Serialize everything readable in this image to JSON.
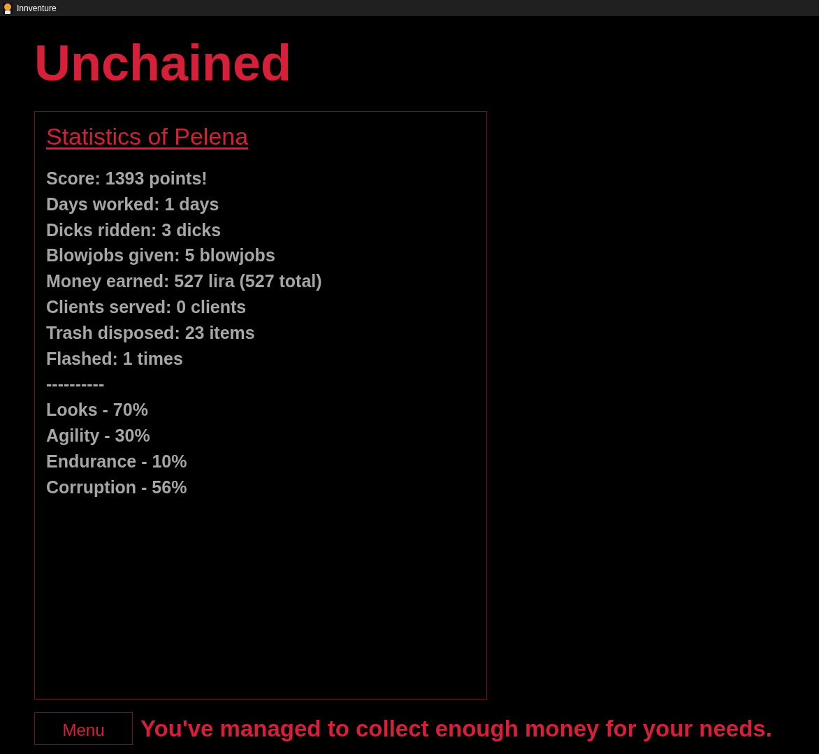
{
  "window": {
    "title": "Innventure"
  },
  "heading": "Unchained",
  "panel": {
    "title": "Statistics of Pelena",
    "lines": [
      "Score: 1393 points!",
      "Days worked: 1 days",
      "Dicks ridden: 3 dicks",
      "Blowjobs given: 5 blowjobs",
      "Money earned: 527 lira (527 total)",
      "Clients served: 0 clients",
      "Trash disposed: 23 items",
      "Flashed: 1 times",
      "----------",
      "Looks - 70%",
      "Agility - 30%",
      "Endurance - 10%",
      "Corruption - 56%"
    ]
  },
  "menu_button": "Menu",
  "message": "You've managed to collect enough money for your needs."
}
